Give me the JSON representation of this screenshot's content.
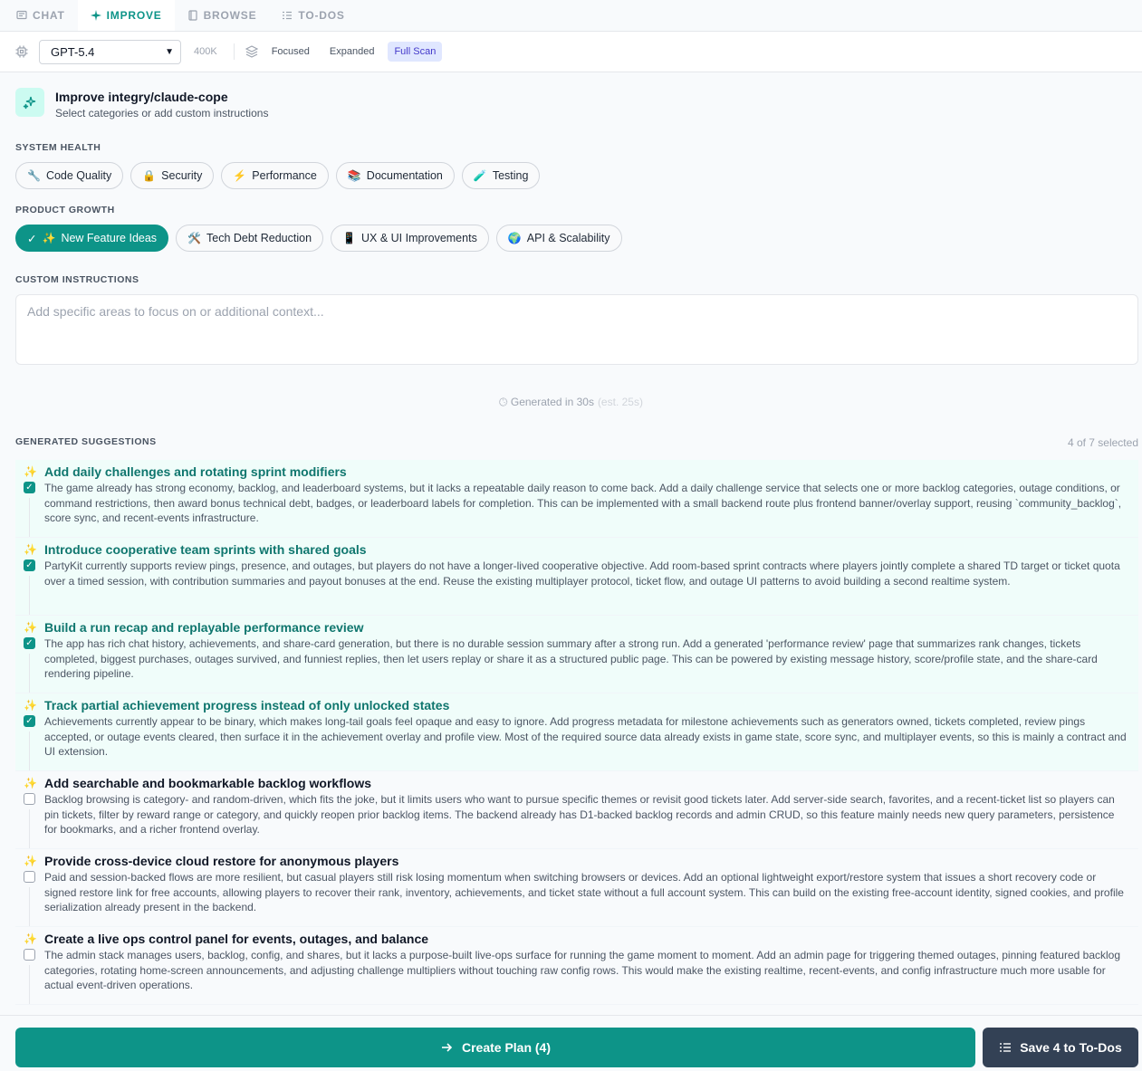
{
  "tabs": [
    {
      "label": "CHAT",
      "icon": "chat-icon",
      "active": false
    },
    {
      "label": "IMPROVE",
      "icon": "sparkle-icon",
      "active": true
    },
    {
      "label": "BROWSE",
      "icon": "book-icon",
      "active": false
    },
    {
      "label": "TO-DOS",
      "icon": "checklist-icon",
      "active": false
    }
  ],
  "toolbar": {
    "model": "GPT-5.4",
    "context": "400K",
    "modes": [
      "Focused",
      "Expanded",
      "Full Scan"
    ],
    "active_mode": "Full Scan"
  },
  "header": {
    "title": "Improve integry/claude-cope",
    "subtitle": "Select categories or add custom instructions"
  },
  "system_health": {
    "label": "SYSTEM HEALTH",
    "items": [
      {
        "emoji": "🔧",
        "label": "Code Quality"
      },
      {
        "emoji": "🔒",
        "label": "Security"
      },
      {
        "emoji": "⚡",
        "label": "Performance"
      },
      {
        "emoji": "📚",
        "label": "Documentation"
      },
      {
        "emoji": "🧪",
        "label": "Testing"
      }
    ]
  },
  "product_growth": {
    "label": "PRODUCT GROWTH",
    "items": [
      {
        "emoji": "✨",
        "label": "New Feature Ideas",
        "selected": true
      },
      {
        "emoji": "🛠️",
        "label": "Tech Debt Reduction",
        "selected": false
      },
      {
        "emoji": "📱",
        "label": "UX & UI Improvements",
        "selected": false
      },
      {
        "emoji": "🌍",
        "label": "API & Scalability",
        "selected": false
      }
    ]
  },
  "custom": {
    "label": "CUSTOM INSTRUCTIONS",
    "placeholder": "Add specific areas to focus on or additional context..."
  },
  "generated": {
    "text": "Generated in 30s",
    "estimate": "(est. 25s)"
  },
  "suggestions_header": {
    "label": "GENERATED SUGGESTIONS",
    "count": "4 of 7 selected"
  },
  "suggestions": [
    {
      "checked": true,
      "title": "Add daily challenges and rotating sprint modifiers",
      "desc": "The game already has strong economy, backlog, and leaderboard systems, but it lacks a repeatable daily reason to come back. Add a daily challenge service that selects one or more backlog categories, outage conditions, or command restrictions, then award bonus technical debt, badges, or leaderboard labels for completion. This can be implemented with a small backend route plus frontend banner/overlay support, reusing `community_backlog`, score sync, and recent-events infrastructure."
    },
    {
      "checked": true,
      "title": "Introduce cooperative team sprints with shared goals",
      "desc": "PartyKit currently supports review pings, presence, and outages, but players do not have a longer-lived cooperative objective. Add room-based sprint contracts where players jointly complete a shared TD target or ticket quota over a timed session, with contribution summaries and payout bonuses at the end. Reuse the existing multiplayer protocol, ticket flow, and outage UI patterns to avoid building a second realtime system."
    },
    {
      "checked": true,
      "title": "Build a run recap and replayable performance review",
      "desc": "The app has rich chat history, achievements, and share-card generation, but there is no durable session summary after a strong run. Add a generated 'performance review' page that summarizes rank changes, tickets completed, biggest purchases, outages survived, and funniest replies, then let users replay or share it as a structured public page. This can be powered by existing message history, score/profile state, and the share-card rendering pipeline."
    },
    {
      "checked": true,
      "title": "Track partial achievement progress instead of only unlocked states",
      "desc": "Achievements currently appear to be binary, which makes long-tail goals feel opaque and easy to ignore. Add progress metadata for milestone achievements such as generators owned, tickets completed, review pings accepted, or outage events cleared, then surface it in the achievement overlay and profile view. Most of the required source data already exists in game state, score sync, and multiplayer events, so this is mainly a contract and UI extension."
    },
    {
      "checked": false,
      "title": "Add searchable and bookmarkable backlog workflows",
      "desc": "Backlog browsing is category- and random-driven, which fits the joke, but it limits users who want to pursue specific themes or revisit good tickets later. Add server-side search, favorites, and a recent-ticket list so players can pin tickets, filter by reward range or category, and quickly reopen prior backlog items. The backend already has D1-backed backlog records and admin CRUD, so this feature mainly needs new query parameters, persistence for bookmarks, and a richer frontend overlay."
    },
    {
      "checked": false,
      "title": "Provide cross-device cloud restore for anonymous players",
      "desc": "Paid and session-backed flows are more resilient, but casual players still risk losing momentum when switching browsers or devices. Add an optional lightweight export/restore system that issues a short recovery code or signed restore link for free accounts, allowing players to recover their rank, inventory, achievements, and ticket state without a full account system. This can build on the existing free-account identity, signed cookies, and profile serialization already present in the backend."
    },
    {
      "checked": false,
      "title": "Create a live ops control panel for events, outages, and balance",
      "desc": "The admin stack manages users, backlog, config, and shares, but it lacks a purpose-built live-ops surface for running the game moment to moment. Add an admin page for triggering themed outages, pinning featured backlog categories, rotating home-screen announcements, and adjusting challenge multipliers without touching raw config rows. This would make the existing realtime, recent-events, and config infrastructure much more usable for actual event-driven operations."
    }
  ],
  "footer": {
    "plan_label": "Create Plan (4)",
    "save_label": "Save 4 to To-Dos"
  },
  "colors": {
    "accent": "#0d9488",
    "dark_button": "#334155",
    "mode_active": "#e0e7ff"
  }
}
